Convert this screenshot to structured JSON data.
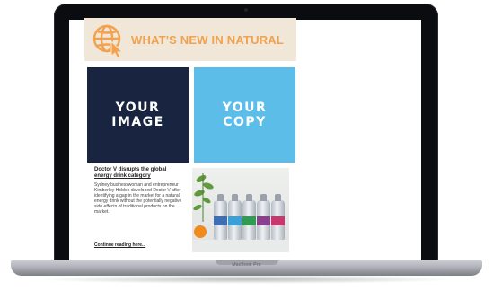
{
  "device": {
    "model_label": "MacBook Pro"
  },
  "email": {
    "banner": {
      "title": "WHAT'S NEW IN NATURAL",
      "icon": "globe-cursor-icon",
      "background_color": "#f0e7d8",
      "accent_color": "#f3a14d"
    },
    "blocks": [
      {
        "text_line1": "YOUR",
        "text_line2": "IMAGE",
        "color": "#182440"
      },
      {
        "text_line1": "YOUR",
        "text_line2": "COPY",
        "color": "#5cbde9"
      }
    ],
    "article": {
      "title": "Doctor V disrupts the global energy drink category",
      "body": "Sydney businesswoman and entrepreneur Kimberley Holden developed Doctor V after identifying a gap in the market for a natural energy drink without the potentially negative side effects of traditional products on the market.",
      "link": "Continue reading here..."
    },
    "photo": {
      "subject": "product-bottles-photo",
      "label_colors": [
        "#3c6fb5",
        "#3aa0d8",
        "#2e9c52",
        "#8a3f8f",
        "#c8386c"
      ]
    }
  }
}
